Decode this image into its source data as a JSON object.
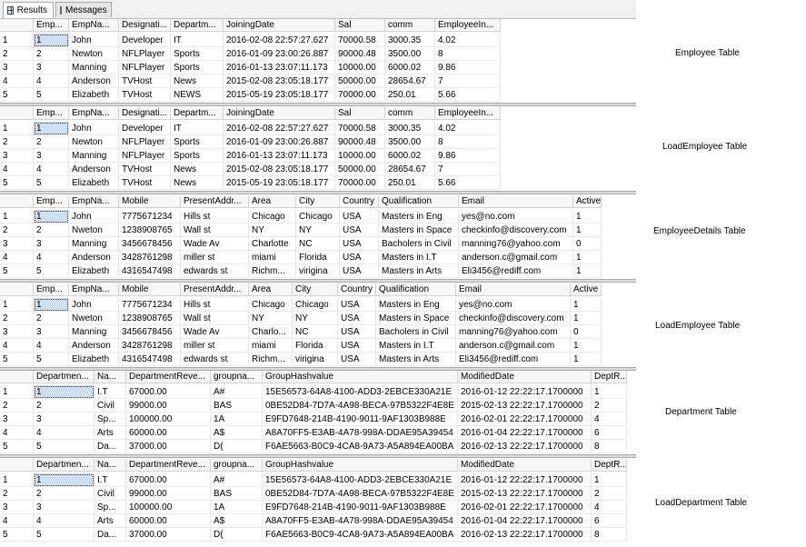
{
  "tabs": [
    {
      "label": "Results",
      "icon": "grid-icon",
      "active": true
    },
    {
      "label": "Messages",
      "icon": "message-icon",
      "active": false
    }
  ],
  "grids": [
    {
      "side_label": "Employee Table",
      "columns": [
        "",
        "Emp...",
        "EmpNa...",
        "Designati...",
        "Departm...",
        "JoiningDate",
        "Sal",
        "comm",
        "EmployeeIn..."
      ],
      "rows": [
        [
          "1",
          "1",
          "John",
          "Developer",
          "IT",
          "2016-02-08 22:57:27.627",
          "70000.58",
          "3000.35",
          "4.02"
        ],
        [
          "2",
          "2",
          "Newton",
          "NFLPlayer",
          "Sports",
          "2016-01-09 23:00:26.887",
          "90000.48",
          "3500.00",
          "8"
        ],
        [
          "3",
          "3",
          "Manning",
          "NFLPlayer",
          "Sports",
          "2016-01-13 23:07:11.173",
          "10000.00",
          "6000.02",
          "9.86"
        ],
        [
          "4",
          "4",
          "Anderson",
          "TVHost",
          "News",
          "2015-02-08 23:05:18.177",
          "50000.00",
          "28654.67",
          "7"
        ],
        [
          "5",
          "5",
          "Elizabeth",
          "TVHost",
          "NEWS",
          "2015-05-19 23:05:18.177",
          "70000.00",
          "250.01",
          "5.66"
        ]
      ]
    },
    {
      "side_label": "LoadEmployee Table",
      "columns": [
        "",
        "Emp...",
        "EmpNa...",
        "Designati...",
        "Departm...",
        "JoiningDate",
        "Sal",
        "comm",
        "EmployeeIn..."
      ],
      "rows": [
        [
          "1",
          "1",
          "John",
          "Developer",
          "IT",
          "2016-02-08 22:57:27.627",
          "70000.58",
          "3000.35",
          "4.02"
        ],
        [
          "2",
          "2",
          "Newton",
          "NFLPlayer",
          "Sports",
          "2016-01-09 23:00:26.887",
          "90000.48",
          "3500.00",
          "8"
        ],
        [
          "3",
          "3",
          "Manning",
          "NFLPlayer",
          "Sports",
          "2016-01-13 23:07:11.173",
          "10000.00",
          "6000.02",
          "9.86"
        ],
        [
          "4",
          "4",
          "Anderson",
          "TVHost",
          "News",
          "2015-02-08 23:05:18.177",
          "50000.00",
          "28654.67",
          "7"
        ],
        [
          "5",
          "5",
          "Elizabeth",
          "TVHost",
          "News",
          "2015-05-19 23:05:18.177",
          "70000.00",
          "250.01",
          "5.66"
        ]
      ]
    },
    {
      "side_label": "EmployeeDetails Table",
      "columns": [
        "",
        "Emp...",
        "EmpNa...",
        "Mobile",
        "PresentAddr...",
        "Area",
        "City",
        "Country",
        "Qualification",
        "Email",
        "Active"
      ],
      "rows": [
        [
          "1",
          "1",
          "John",
          "7775671234",
          "Hills st",
          "Chicago",
          "Chicago",
          "USA",
          "Masters in Eng",
          "yes@no.com",
          "1"
        ],
        [
          "2",
          "2",
          "Nweton",
          "1238908765",
          "Wall st",
          "NY",
          "NY",
          "USA",
          "Masters in Space",
          "checkinfo@discovery.com",
          "1"
        ],
        [
          "3",
          "3",
          "Manning",
          "3456678456",
          "Wade Av",
          "Charlotte",
          "NC",
          "USA",
          "Bacholers in Civil",
          "manning76@yahoo.com",
          "0"
        ],
        [
          "4",
          "4",
          "Anderson",
          "3428761298",
          "miller st",
          "miami",
          "Florida",
          "USA",
          "Masters in I.T",
          "anderson.c@gmail.com",
          "1"
        ],
        [
          "5",
          "5",
          "Elizabeth",
          "4316547498",
          "edwards st",
          "Richm...",
          "virigina",
          "USA",
          "Masters in Arts",
          "Eli3456@rediff.com",
          "1"
        ]
      ]
    },
    {
      "side_label": "LoadEmployee Table",
      "columns": [
        "",
        "Emp...",
        "EmpNa...",
        "Mobile",
        "PresentAddr...",
        "Area",
        "City",
        "Country",
        "Qualification",
        "Email",
        "Active"
      ],
      "rows": [
        [
          "1",
          "1",
          "John",
          "7775671234",
          "Hills st",
          "Chicago",
          "Chicago",
          "USA",
          "Masters in Eng",
          "yes@no.com",
          "1"
        ],
        [
          "2",
          "2",
          "Nweton",
          "1238908765",
          "Wall st",
          "NY",
          "NY",
          "USA",
          "Masters in Space",
          "checkinfo@discovery.com",
          "1"
        ],
        [
          "3",
          "3",
          "Manning",
          "3456678456",
          "Wade Av",
          "Charlo...",
          "NC",
          "USA",
          "Bacholers in Civil",
          "manning76@yahoo.com",
          "0"
        ],
        [
          "4",
          "4",
          "Anderson",
          "3428761298",
          "miller st",
          "miami",
          "Florida",
          "USA",
          "Masters in I.T",
          "anderson.c@gmail.com",
          "1"
        ],
        [
          "5",
          "5",
          "Elizabeth",
          "4316547498",
          "edwards st",
          "Richm...",
          "virigina",
          "USA",
          "Masters in Arts",
          "Eli3456@rediff.com",
          "1"
        ]
      ]
    },
    {
      "side_label": "Department Table",
      "columns": [
        "",
        "Departmen...",
        "Na...",
        "DepartmentReve...",
        "groupna...",
        "GroupHashvalue",
        "ModifiedDate",
        "DeptR..."
      ],
      "rows": [
        [
          "1",
          "1",
          "I.T",
          "67000.00",
          "A#",
          "15E56573-64A8-4100-ADD3-2EBCE330A21E",
          "2016-01-12 22:22:17.1700000",
          "1"
        ],
        [
          "2",
          "2",
          "Civil",
          "99000.00",
          "BAS",
          "0BE52D84-7D7A-4A98-BECA-97B5322F4E8E",
          "2015-02-13 22:22:17.1700000",
          "2"
        ],
        [
          "3",
          "3",
          "Sp...",
          "100000.00",
          "1A",
          "E9FD7648-214B-4190-9011-9AF1303B988E",
          "2016-02-01 22:22:17.1700000",
          "4"
        ],
        [
          "4",
          "4",
          "Arts",
          "60000.00",
          "A$",
          "A8A70FF5-E3AB-4A78-998A-DDAE95A39454",
          "2016-01-04 22:22:17.1700000",
          "6"
        ],
        [
          "5",
          "5",
          "Da...",
          "37000.00",
          "D(",
          "F6AE5663-B0C9-4CA8-9A73-A5A894EA00BA",
          "2016-02-13 22:22:17.1700000",
          "8"
        ]
      ]
    },
    {
      "side_label": "LoadDepartment Table",
      "columns": [
        "",
        "Departmen...",
        "Na...",
        "DepartmentReve...",
        "groupna...",
        "GroupHashvalue",
        "ModifiedDate",
        "DeptR..."
      ],
      "rows": [
        [
          "1",
          "1",
          "I.T",
          "67000.00",
          "A#",
          "15E56573-64A8-4100-ADD3-2EBCE330A21E",
          "2016-01-12 22:22:17.1700000",
          "1"
        ],
        [
          "2",
          "2",
          "Civil",
          "99000.00",
          "BAS",
          "0BE52D84-7D7A-4A98-BECA-97B5322F4E8E",
          "2015-02-13 22:22:17.1700000",
          "2"
        ],
        [
          "3",
          "3",
          "Sp...",
          "100000.00",
          "1A",
          "E9FD7648-214B-4190-9011-9AF1303B988E",
          "2016-02-01 22:22:17.1700000",
          "4"
        ],
        [
          "4",
          "4",
          "Arts",
          "60000.00",
          "A$",
          "A8A70FF5-E3AB-4A78-998A-DDAE95A39454",
          "2016-01-04 22:22:17.1700000",
          "6"
        ],
        [
          "5",
          "5",
          "Da...",
          "37000.00",
          "D(",
          "F6AE5663-B0C9-4CA8-9A73-A5A894EA00BA",
          "2016-02-13 22:22:17.1700000",
          "8"
        ]
      ]
    }
  ]
}
